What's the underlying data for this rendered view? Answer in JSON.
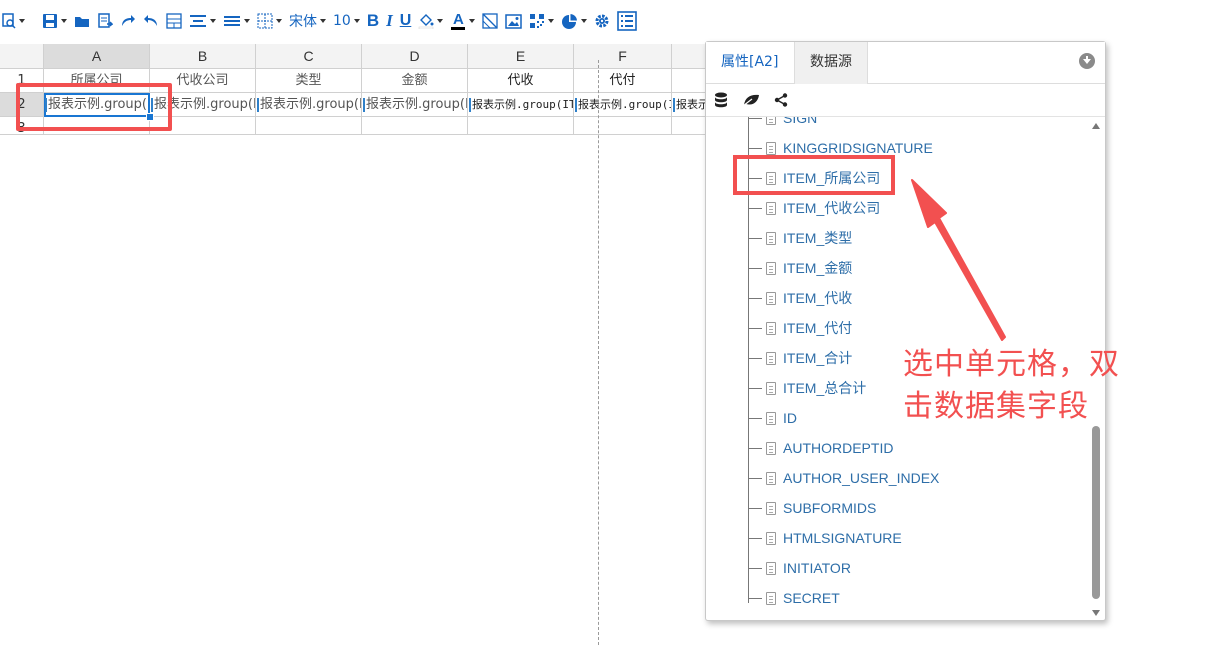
{
  "toolbar": {
    "font_name": "宋体",
    "font_size": "10",
    "bold": "B",
    "italic": "I",
    "underline": "U",
    "text_color_glyph": "A"
  },
  "grid": {
    "columns": [
      "A",
      "B",
      "C",
      "D",
      "E",
      "F",
      ""
    ],
    "active_column": "A",
    "rows": [
      {
        "number": "1",
        "cells": [
          "所属公司",
          "代收公司",
          "类型",
          "金额",
          "代收",
          "代付",
          ""
        ]
      },
      {
        "number": "2",
        "cells": [
          "报表示例.group(I",
          "报表示例.group(I",
          "报表示例.group(I",
          "报表示例.group(I",
          "报表示例.group(IT",
          "报表示例.group(I",
          "报表示"
        ]
      },
      {
        "number": "3",
        "cells": [
          "",
          "",
          "",
          "",
          "",
          "",
          ""
        ]
      }
    ]
  },
  "panel": {
    "tabs": [
      "属性[A2]",
      "数据源"
    ],
    "active_tab": "数据源",
    "fields": [
      "SIGN",
      "KINGGRIDSIGNATURE",
      "ITEM_所属公司",
      "ITEM_代收公司",
      "ITEM_类型",
      "ITEM_金额",
      "ITEM_代收",
      "ITEM_代付",
      "ITEM_合计",
      "ITEM_总合计",
      "ID",
      "AUTHORDEPTID",
      "AUTHOR_USER_INDEX",
      "SUBFORMIDS",
      "HTMLSIGNATURE",
      "INITIATOR",
      "SECRET"
    ],
    "highlighted_field": "ITEM_所属公司"
  },
  "annotation": {
    "text": "选中单元格，双击数据集字段"
  },
  "colors": {
    "accent": "#1565c0",
    "annotation": "#f25050",
    "selection": "#1976d2"
  },
  "icons": [
    "preview-icon",
    "save-icon",
    "open-folder-icon",
    "export-icon",
    "redo-icon",
    "undo-icon",
    "merge-cells-icon",
    "align-center-icon",
    "line-spacing-icon",
    "borders-icon",
    "fill-color-icon",
    "font-color-icon",
    "clear-format-icon",
    "image-icon",
    "qrcode-icon",
    "chart-icon",
    "settings-icon",
    "datasource-panel-icon",
    "database-icon",
    "leaf-icon",
    "share-icon"
  ]
}
